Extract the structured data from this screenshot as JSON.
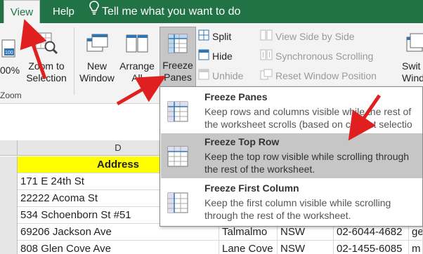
{
  "tabs": [
    {
      "label": "View",
      "active": true
    },
    {
      "label": "Help",
      "active": false
    }
  ],
  "tell_me": "Tell me what you want to do",
  "ribbon": {
    "zoom_partial": "00%",
    "zoom_to_selection": [
      "Zoom to",
      "Selection"
    ],
    "zoom_group": "Zoom",
    "new_window": [
      "New",
      "Window"
    ],
    "arrange_all": [
      "Arrange",
      "All"
    ],
    "freeze_panes": [
      "Freeze",
      "Panes"
    ],
    "freeze_caret": "▾",
    "split": "Split",
    "hide": "Hide",
    "unhide": "Unhide",
    "view_side_by_side": "View Side by Side",
    "synchronous_scrolling": "Synchronous Scrolling",
    "reset_window_position": "Reset Window Position",
    "switch_partial": "Swit",
    "switch_partial2": "Windo"
  },
  "sheet": {
    "col_d": "D",
    "address_header": "Address",
    "rows": [
      {
        "address": "171 E 24th St",
        "city": "",
        "state": "",
        "phone": ""
      },
      {
        "address": "22222 Acoma St",
        "city": "",
        "state": "",
        "phone": ""
      },
      {
        "address": "534 Schoenborn St #51",
        "city": "",
        "state": "",
        "phone": ""
      },
      {
        "address": "69206 Jackson Ave",
        "city": "Talmalmo",
        "state": "NSW",
        "phone": "02-6044-4682",
        "extra": "ge"
      },
      {
        "address": "808 Glen Cove Ave",
        "city": "Lane Cove",
        "state": "NSW",
        "phone": "02-1455-6085",
        "extra": "m"
      }
    ]
  },
  "menu": {
    "items": [
      {
        "title": "Freeze Panes",
        "desc1": "Keep rows and columns visible while the rest of",
        "desc2": "the worksheet scrolls (based on current selectio",
        "selected": false
      },
      {
        "title": "Freeze Top Row",
        "desc1": "Keep the top row visible while scrolling through",
        "desc2": "the rest of the worksheet.",
        "selected": true
      },
      {
        "title": "Freeze First Column",
        "desc1": "Keep the first column visible while scrolling",
        "desc2": "through the rest of the worksheet.",
        "selected": false
      }
    ]
  },
  "colors": {
    "excel_green": "#217346",
    "highlight_yellow": "#ffff00",
    "arrow_red": "#e02020"
  }
}
